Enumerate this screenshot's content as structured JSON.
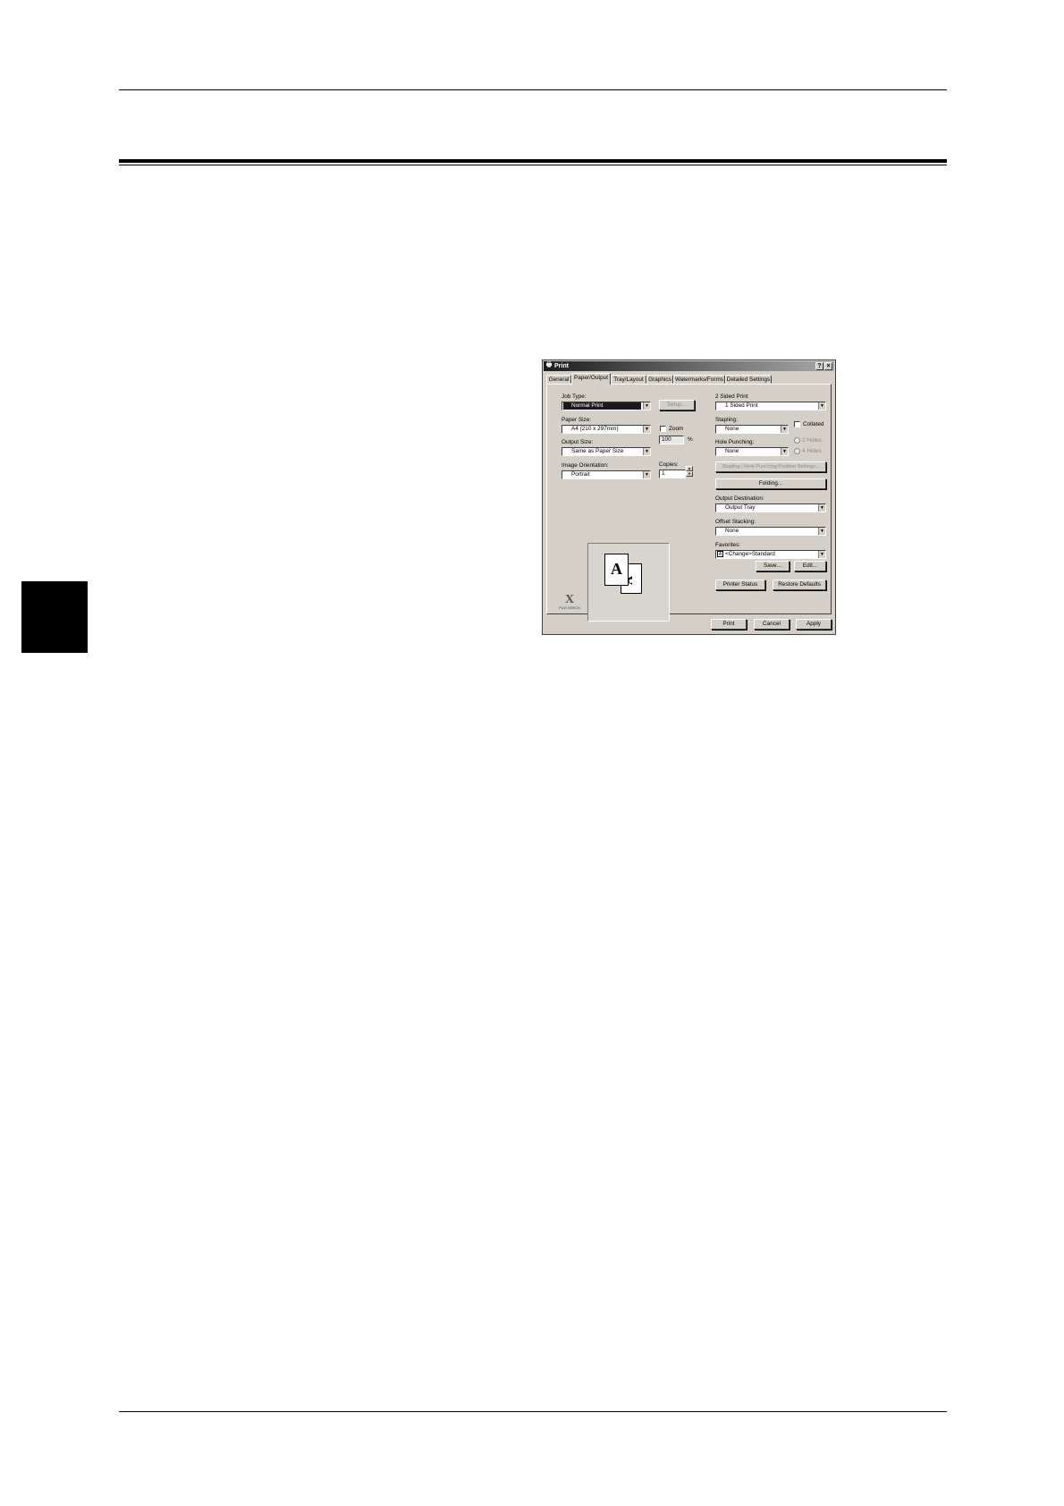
{
  "dialog": {
    "title": "Print",
    "help_glyph": "?",
    "close_glyph": "×",
    "title_icon": "printer-icon",
    "tabs": [
      "General",
      "Paper/Output",
      "Tray/Layout",
      "Graphics",
      "Watermarks/Forms",
      "Detailed Settings"
    ],
    "active_tab": "Paper/Output",
    "job_type": {
      "label": "Job Type:",
      "value": "Normal Print",
      "setup_button": "Setup..."
    },
    "paper_size": {
      "label": "Paper Size:",
      "value": "A4 (210 x 297mm)"
    },
    "zoom": {
      "label": "Zoom",
      "value": "100",
      "unit": "%",
      "checked": false
    },
    "output_size": {
      "label": "Output Size:",
      "value": "Same as Paper Size"
    },
    "image_orientation": {
      "label": "Image Orientation:",
      "value": "Portrait"
    },
    "copies": {
      "label": "Copies:",
      "value": "1"
    },
    "two_sided": {
      "label": "2 Sided Print",
      "value": "1 Sided Print"
    },
    "stapling": {
      "label": "Stapling:",
      "value": "None"
    },
    "collated": {
      "label": "Collated",
      "checked": false
    },
    "hole_punching": {
      "label": "Hole Punching:",
      "value": "None"
    },
    "holes": [
      "2 Holes",
      "4 Holes"
    ],
    "stapling_position_button": "Stapling / Hole Punching Position Settings...",
    "folding_button": "Folding...",
    "output_destination": {
      "label": "Output Destination:",
      "value": "Output Tray"
    },
    "offset_stacking": {
      "label": "Offset Stacking:",
      "value": "None"
    },
    "favorites": {
      "label": "Favorites:",
      "badge": "A",
      "value": "<Change>Standard"
    },
    "save_button": "Save...",
    "edit_button": "Edit...",
    "printer_status_button": "Printer Status",
    "restore_defaults_button": "Restore Defaults",
    "print_button": "Print",
    "cancel_button": "Cancel",
    "apply_button": "Apply",
    "preview": {
      "front_letter": "A",
      "back_letter": "A"
    },
    "logo": {
      "mark": "X",
      "text": "FUJI XEROX"
    },
    "arrow_glyph": "▼",
    "spin_up": "▲",
    "spin_down": "▼"
  }
}
